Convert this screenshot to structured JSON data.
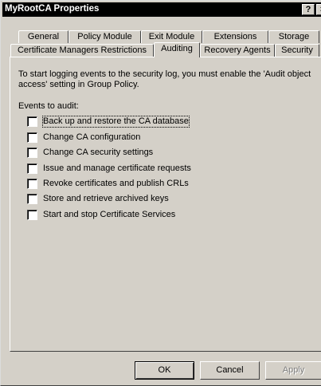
{
  "window": {
    "title": "MyRootCA Properties",
    "help_label": "?",
    "close_label": "×"
  },
  "tabs_row1": [
    {
      "label": "General"
    },
    {
      "label": "Policy Module"
    },
    {
      "label": "Exit Module"
    },
    {
      "label": "Extensions"
    },
    {
      "label": "Storage"
    }
  ],
  "tabs_row2": [
    {
      "label": "Certificate Managers Restrictions"
    },
    {
      "label": "Auditing",
      "active": true
    },
    {
      "label": "Recovery Agents"
    },
    {
      "label": "Security"
    }
  ],
  "auditing": {
    "intro": "To start logging events to the security log, you must enable the 'Audit object access' setting in Group Policy.",
    "events_label": "Events to audit:",
    "events": [
      {
        "label": "Back up and restore the CA database",
        "checked": false
      },
      {
        "label": "Change CA configuration",
        "checked": false
      },
      {
        "label": "Change CA security settings",
        "checked": false
      },
      {
        "label": "Issue and manage certificate requests",
        "checked": false
      },
      {
        "label": "Revoke certificates and publish CRLs",
        "checked": false
      },
      {
        "label": "Store and retrieve archived keys",
        "checked": false
      },
      {
        "label": "Start and stop Certificate Services",
        "checked": false
      }
    ]
  },
  "buttons": {
    "ok": "OK",
    "cancel": "Cancel",
    "apply": "Apply"
  }
}
